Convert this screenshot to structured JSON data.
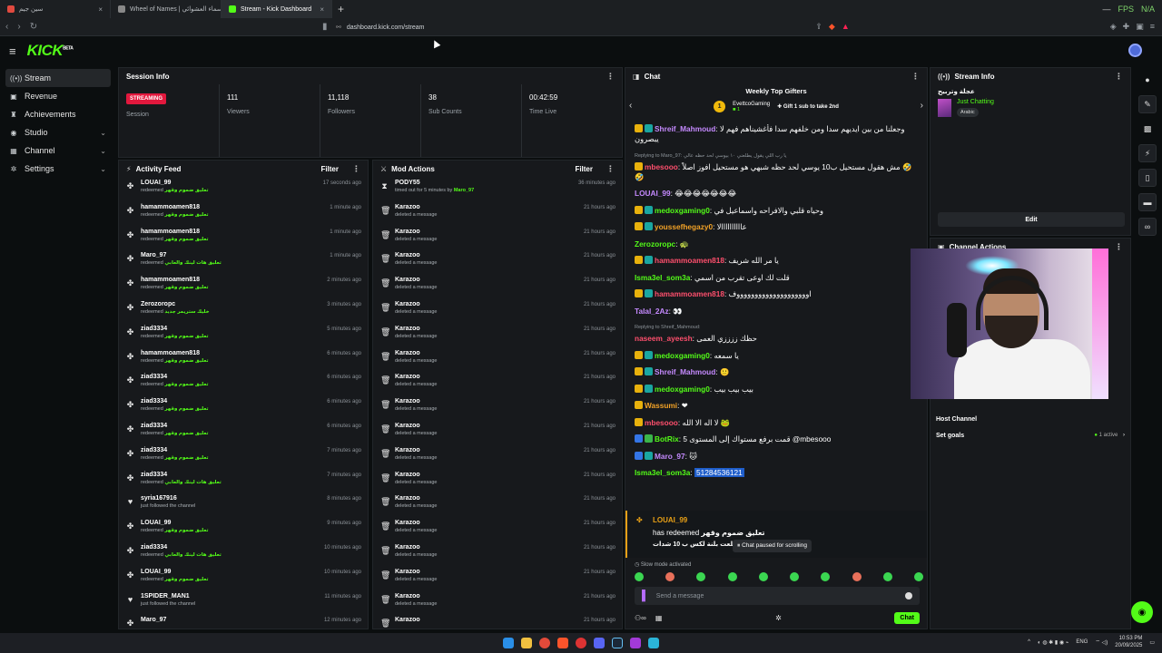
{
  "browser": {
    "tabs": [
      {
        "label": "سين جيم",
        "fav": "#e04a3f",
        "active": false
      },
      {
        "label": "Wheel of Names | عجلة الأسماء العشوائي",
        "fav": "#888888",
        "active": false
      },
      {
        "label": "Stream - Kick Dashboard",
        "fav": "#53fc18",
        "active": true
      }
    ],
    "fps_label": "FPS",
    "fps_value": "N/A",
    "url": "dashboard.kick.com/stream"
  },
  "brand": {
    "logo": "KICK",
    "logo_sup": "BETA"
  },
  "sidebar": {
    "items": [
      {
        "label": "Stream",
        "icon": "broadcast-icon",
        "glyph": "((•))",
        "selected": true,
        "chev": false
      },
      {
        "label": "Revenue",
        "icon": "wallet-icon",
        "glyph": "▣",
        "selected": false,
        "chev": false
      },
      {
        "label": "Achievements",
        "icon": "trophy-icon",
        "glyph": "♜",
        "selected": false,
        "chev": false
      },
      {
        "label": "Studio",
        "icon": "globe-icon",
        "glyph": "◉",
        "selected": false,
        "chev": true
      },
      {
        "label": "Channel",
        "icon": "grid-icon",
        "glyph": "▦",
        "selected": false,
        "chev": true
      },
      {
        "label": "Settings",
        "icon": "gear-icon",
        "glyph": "✲",
        "selected": false,
        "chev": true
      }
    ]
  },
  "session": {
    "title": "Session Info",
    "status": "STREAMING",
    "stats": [
      {
        "value": "",
        "label": "Session"
      },
      {
        "value": "111",
        "label": "Viewers"
      },
      {
        "value": "11,118",
        "label": "Followers"
      },
      {
        "value": "38",
        "label": "Sub Counts"
      },
      {
        "value": "00:42:59",
        "label": "Time Live"
      }
    ]
  },
  "activity": {
    "title": "Activity Feed",
    "filter": "Filter",
    "items": [
      {
        "icon": "redeem-icon",
        "glyph": "✤",
        "name": "LOUAI_99",
        "action": "redeemed",
        "reward": "تعليق ضموم وقهر",
        "time": "17 seconds ago"
      },
      {
        "icon": "redeem-icon",
        "glyph": "✤",
        "name": "hamammoamen818",
        "action": "redeemed",
        "reward": "تعليق ضموم وقهر",
        "time": "1 minute ago"
      },
      {
        "icon": "redeem-icon",
        "glyph": "✤",
        "name": "hamammoamen818",
        "action": "redeemed",
        "reward": "تعليق ضموم وقهر",
        "time": "1 minute ago"
      },
      {
        "icon": "redeem-icon",
        "glyph": "✤",
        "name": "Maro_97",
        "action": "redeemed",
        "reward": "تعليق هات لينك والعابي",
        "time": "1 minute ago"
      },
      {
        "icon": "redeem-icon",
        "glyph": "✤",
        "name": "hamammoamen818",
        "action": "redeemed",
        "reward": "تعليق ضموم وقهر",
        "time": "2 minutes ago"
      },
      {
        "icon": "redeem-icon",
        "glyph": "✤",
        "name": "Zerozoropc",
        "action": "redeemed",
        "reward": "خليك ستريمر جديد",
        "time": "3 minutes ago"
      },
      {
        "icon": "redeem-icon",
        "glyph": "✤",
        "name": "ziad3334",
        "action": "redeemed",
        "reward": "تعليق ضموم وقهر",
        "time": "5 minutes ago"
      },
      {
        "icon": "redeem-icon",
        "glyph": "✤",
        "name": "hamammoamen818",
        "action": "redeemed",
        "reward": "تعليق ضموم وقهر",
        "time": "6 minutes ago"
      },
      {
        "icon": "redeem-icon",
        "glyph": "✤",
        "name": "ziad3334",
        "action": "redeemed",
        "reward": "تعليق ضموم وقهر",
        "time": "6 minutes ago"
      },
      {
        "icon": "redeem-icon",
        "glyph": "✤",
        "name": "ziad3334",
        "action": "redeemed",
        "reward": "تعليق ضموم وقهر",
        "time": "6 minutes ago"
      },
      {
        "icon": "redeem-icon",
        "glyph": "✤",
        "name": "ziad3334",
        "action": "redeemed",
        "reward": "تعليق ضموم وقهر",
        "time": "6 minutes ago"
      },
      {
        "icon": "redeem-icon",
        "glyph": "✤",
        "name": "ziad3334",
        "action": "redeemed",
        "reward": "تعليق ضموم وقهر",
        "time": "7 minutes ago"
      },
      {
        "icon": "redeem-icon",
        "glyph": "✤",
        "name": "ziad3334",
        "action": "redeemed",
        "reward": "تعليق هات لينك والعابي",
        "time": "7 minutes ago"
      },
      {
        "icon": "heart-icon",
        "glyph": "♥",
        "name": "syria167916",
        "action": "just followed the channel",
        "reward": "",
        "time": "8 minutes ago"
      },
      {
        "icon": "redeem-icon",
        "glyph": "✤",
        "name": "LOUAI_99",
        "action": "redeemed",
        "reward": "تعليق ضموم وقهر",
        "time": "9 minutes ago"
      },
      {
        "icon": "redeem-icon",
        "glyph": "✤",
        "name": "ziad3334",
        "action": "redeemed",
        "reward": "تعليق هات لينك والعابي",
        "time": "10 minutes ago"
      },
      {
        "icon": "redeem-icon",
        "glyph": "✤",
        "name": "LOUAI_99",
        "action": "redeemed",
        "reward": "تعليق ضموم وقهر",
        "time": "10 minutes ago"
      },
      {
        "icon": "heart-icon",
        "glyph": "♥",
        "name": "1SPIDER_MAN1",
        "action": "just followed the channel",
        "reward": "",
        "time": "11 minutes ago"
      },
      {
        "icon": "redeem-icon",
        "glyph": "✤",
        "name": "Maro_97",
        "action": "",
        "reward": "",
        "time": "12 minutes ago"
      }
    ]
  },
  "mod": {
    "title": "Mod Actions",
    "filter": "Filter",
    "items": [
      {
        "icon": "hourglass-icon",
        "glyph": "⧗",
        "name": "PODY55",
        "action": "timed out for 5 minutes by",
        "by": "Maro_97",
        "time": "36 minutes ago"
      },
      {
        "icon": "trash-icon",
        "glyph": "🗑",
        "name": "Karazoo",
        "action": "deleted a message",
        "by": "",
        "time": "21 hours ago"
      },
      {
        "icon": "trash-icon",
        "glyph": "🗑",
        "name": "Karazoo",
        "action": "deleted a message",
        "by": "",
        "time": "21 hours ago"
      },
      {
        "icon": "trash-icon",
        "glyph": "🗑",
        "name": "Karazoo",
        "action": "deleted a message",
        "by": "",
        "time": "21 hours ago"
      },
      {
        "icon": "trash-icon",
        "glyph": "🗑",
        "name": "Karazoo",
        "action": "deleted a message",
        "by": "",
        "time": "21 hours ago"
      },
      {
        "icon": "trash-icon",
        "glyph": "🗑",
        "name": "Karazoo",
        "action": "deleted a message",
        "by": "",
        "time": "21 hours ago"
      },
      {
        "icon": "trash-icon",
        "glyph": "🗑",
        "name": "Karazoo",
        "action": "deleted a message",
        "by": "",
        "time": "21 hours ago"
      },
      {
        "icon": "trash-icon",
        "glyph": "🗑",
        "name": "Karazoo",
        "action": "deleted a message",
        "by": "",
        "time": "21 hours ago"
      },
      {
        "icon": "trash-icon",
        "glyph": "🗑",
        "name": "Karazoo",
        "action": "deleted a message",
        "by": "",
        "time": "21 hours ago"
      },
      {
        "icon": "trash-icon",
        "glyph": "🗑",
        "name": "Karazoo",
        "action": "deleted a message",
        "by": "",
        "time": "21 hours ago"
      },
      {
        "icon": "trash-icon",
        "glyph": "🗑",
        "name": "Karazoo",
        "action": "deleted a message",
        "by": "",
        "time": "21 hours ago"
      },
      {
        "icon": "trash-icon",
        "glyph": "🗑",
        "name": "Karazoo",
        "action": "deleted a message",
        "by": "",
        "time": "21 hours ago"
      },
      {
        "icon": "trash-icon",
        "glyph": "🗑",
        "name": "Karazoo",
        "action": "deleted a message",
        "by": "",
        "time": "21 hours ago"
      },
      {
        "icon": "trash-icon",
        "glyph": "🗑",
        "name": "Karazoo",
        "action": "deleted a message",
        "by": "",
        "time": "21 hours ago"
      },
      {
        "icon": "trash-icon",
        "glyph": "🗑",
        "name": "Karazoo",
        "action": "deleted a message",
        "by": "",
        "time": "21 hours ago"
      },
      {
        "icon": "trash-icon",
        "glyph": "🗑",
        "name": "Karazoo",
        "action": "deleted a message",
        "by": "",
        "time": "21 hours ago"
      },
      {
        "icon": "trash-icon",
        "glyph": "🗑",
        "name": "Karazoo",
        "action": "deleted a message",
        "by": "",
        "time": "21 hours ago"
      },
      {
        "icon": "trash-icon",
        "glyph": "🗑",
        "name": "Karazoo",
        "action": "deleted a message",
        "by": "",
        "time": "21 hours ago"
      },
      {
        "icon": "trash-icon",
        "glyph": "🗑",
        "name": "Karazoo",
        "action": "",
        "by": "",
        "time": "21 hours ago"
      }
    ]
  },
  "chat": {
    "title": "Chat",
    "gifters_title": "Weekly Top Gifters",
    "gifter": {
      "rank": "1",
      "name": "EvettcoGaming",
      "count": "1"
    },
    "gift_prompt": "Gift 1 sub to take 2nd",
    "messages": [
      {
        "badges": [
          "y",
          "t"
        ],
        "user": "Shreif_Mahmoud",
        "color": "#c58aff",
        "reply": "",
        "text": "وجعلنا من بين ايديهم سدا ومن خلفهم سدا فأغشيناهم فهم لا يبصرون"
      },
      {
        "badges": [
          "y"
        ],
        "user": "mbesooo",
        "color": "#ff4f6d",
        "reply": "Replying to Maro_97: يا رب اللي يقول يطلعني ١٠ بيوسي لحد حظه عالي",
        "text": "مش هقول مستحيل ب10 يوسي لحد حظه شبهي هو مستحيل افوز اصلاً 🤣🤣"
      },
      {
        "badges": [],
        "user": "LOUAI_99",
        "color": "#c58aff",
        "reply": "",
        "text": "😂😂😂😂😂😂😂"
      },
      {
        "badges": [
          "y",
          "t"
        ],
        "user": "medoxgaming0",
        "color": "#53fc18",
        "reply": "",
        "text": "وحياه قلبي والافراحه واسماعيل في"
      },
      {
        "badges": [
          "y",
          "t"
        ],
        "user": "youssefhegazy0",
        "color": "#f2a227",
        "reply": "",
        "text": "عاااااااااالا"
      },
      {
        "badges": [],
        "user": "Zerozoropc",
        "color": "#53fc18",
        "reply": "",
        "text": "🐢"
      },
      {
        "badges": [
          "y",
          "t"
        ],
        "user": "hamammoamen818",
        "color": "#ff4f6d",
        "reply": "",
        "text": "يا مر الله شريف"
      },
      {
        "badges": [],
        "user": "Isma3el_som3a",
        "color": "#53fc18",
        "reply": "",
        "text": "قلت لك اوعى تقرب من اسمي"
      },
      {
        "badges": [
          "y",
          "t"
        ],
        "user": "hamammoamen818",
        "color": "#ff4f6d",
        "reply": "",
        "text": "اووووووووووووووووووووف"
      },
      {
        "badges": [],
        "user": "Talal_2Az",
        "color": "#c58aff",
        "reply": "",
        "text": "👀"
      },
      {
        "badges": [],
        "user": "naseem_ayeesh",
        "color": "#ff4f6d",
        "reply": "Replying to Shreif_Mahmoud:",
        "text": "حظك ززززي العمى"
      },
      {
        "badges": [
          "y",
          "t"
        ],
        "user": "medoxgaming0",
        "color": "#53fc18",
        "reply": "",
        "text": "يا سمعه"
      },
      {
        "badges": [
          "y",
          "t"
        ],
        "user": "Shreif_Mahmoud",
        "color": "#c58aff",
        "reply": "",
        "text": "🙂"
      },
      {
        "badges": [
          "y",
          "t"
        ],
        "user": "medoxgaming0",
        "color": "#53fc18",
        "reply": "",
        "text": "بيب بيب بيب"
      },
      {
        "badges": [
          "y"
        ],
        "user": "Wassumi",
        "color": "#f2a227",
        "reply": "",
        "text": "❤"
      },
      {
        "badges": [
          "y"
        ],
        "user": "mbesooo",
        "color": "#ff4f6d",
        "reply": "",
        "text": "لا اله الا الله 🐸"
      },
      {
        "badges": [
          "bl",
          "g"
        ],
        "user": "BotRix",
        "color": "#53fc18",
        "reply": "",
        "text": "قمت برفع مستواك إلى المستوى 5 @mbesooo"
      },
      {
        "badges": [
          "bl",
          "t"
        ],
        "user": "Maro_97",
        "color": "#c58aff",
        "reply": "",
        "text": "🐱"
      },
      {
        "badges": [],
        "user": "Isma3el_som3a",
        "color": "#53fc18",
        "reply": "",
        "text": "",
        "highlight": "51284536121"
      }
    ],
    "redeem": {
      "user": "LOUAI_99",
      "text": "has redeemed",
      "reward": "تعليق ضموم وقهر",
      "line": "طلعت بلنة لكس ب 10 شدات 😂😂"
    },
    "paused": "Chat paused for scrolling",
    "slow_mode": "Slow mode activated",
    "placeholder": "Send a message",
    "send_label": "Chat"
  },
  "stream_info": {
    "title": "Stream Info",
    "stream_title": "عجلة وتربيح",
    "category": "Just Chatting",
    "tag": "Arabic",
    "edit": "Edit"
  },
  "channel_actions": {
    "title": "Channel Actions",
    "host": "Host Channel",
    "goals": "Set goals",
    "active_count": "1",
    "active_word": "active"
  },
  "taskbar": {
    "lang": "ENG",
    "time": "10:53 PM",
    "date": "20/09/2025"
  },
  "colors": {
    "brand": "#53fc18",
    "live": "#e2183d"
  }
}
